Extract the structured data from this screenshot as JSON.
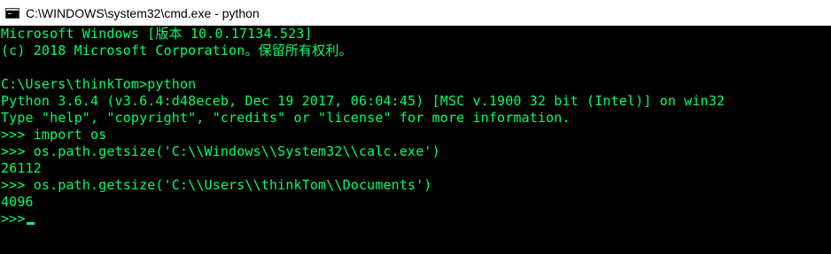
{
  "window": {
    "title": "C:\\WINDOWS\\system32\\cmd.exe - python",
    "icon": "cmd-icon",
    "text_color": "#00ff66",
    "background_color": "#000000"
  },
  "console": {
    "lines": [
      "Microsoft Windows [版本 10.0.17134.523]",
      "(c) 2018 Microsoft Corporation。保留所有权利。",
      "",
      "C:\\Users\\thinkTom>python",
      "Python 3.6.4 (v3.6.4:d48eceb, Dec 19 2017, 06:04:45) [MSC v.1900 32 bit (Intel)] on win32",
      "Type \"help\", \"copyright\", \"credits\" or \"license\" for more information.",
      ">>> import os",
      ">>> os.path.getsize('C:\\\\Windows\\\\System32\\\\calc.exe')",
      "26112",
      ">>> os.path.getsize('C:\\\\Users\\\\thinkTom\\\\Documents')",
      "4096",
      ">>>"
    ]
  }
}
